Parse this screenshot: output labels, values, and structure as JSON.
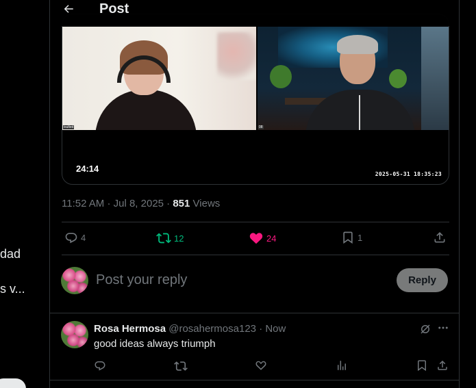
{
  "sidebar_fragments": {
    "line1": "dad",
    "line2": "s v..."
  },
  "header": {
    "title": "Post"
  },
  "video": {
    "duration": "24:14",
    "timestamp": "2025-05-31  18:35:23",
    "left_tag": "isulted",
    "right_tag": "08"
  },
  "post_meta": {
    "time": "11:52 AM",
    "date": "Jul 8, 2025",
    "views_count": "851",
    "views_label": "Views",
    "sep": "·"
  },
  "actions": {
    "replies": "4",
    "reposts": "12",
    "likes": "24",
    "bookmarks": "1"
  },
  "colors": {
    "repost": "#00ba7c",
    "like": "#f91880",
    "muted": "#71767b",
    "text": "#e7e9ea"
  },
  "composer": {
    "placeholder": "Post your reply",
    "button": "Reply"
  },
  "reply": {
    "name": "Rosa Hermosa",
    "handle": "@rosahermosa123",
    "time": "· Now",
    "text": "good ideas always triumph"
  }
}
